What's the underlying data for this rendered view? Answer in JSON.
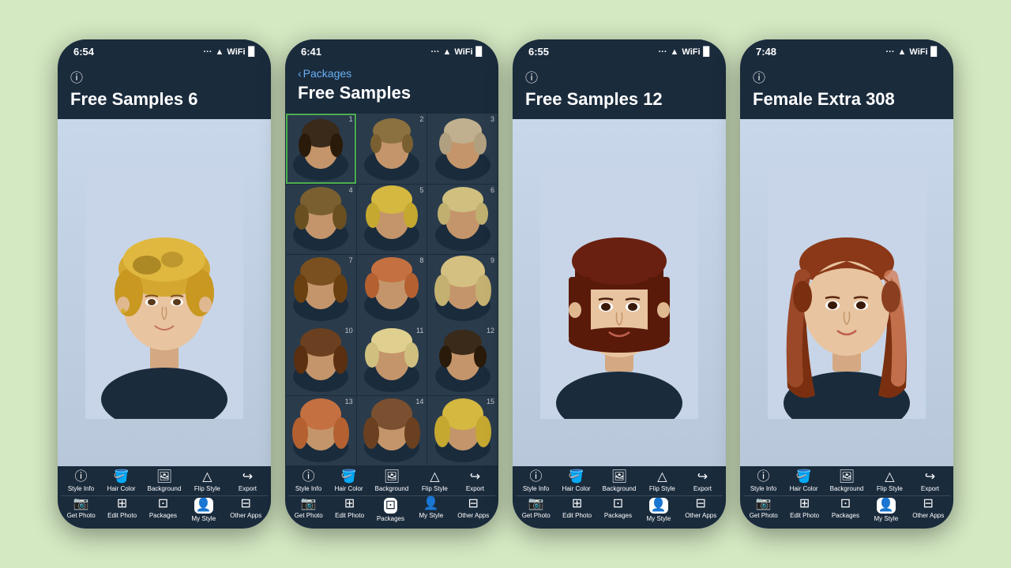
{
  "background_color": "#d4e8c2",
  "phones": [
    {
      "id": "phone1",
      "time": "6:54",
      "title": "Free Samples 6",
      "show_info": true,
      "active_tab": "my_style",
      "type": "main_photo"
    },
    {
      "id": "phone2",
      "time": "6:41",
      "title": "Free Samples",
      "back_label": "Packages",
      "show_back": true,
      "active_tab": "packages",
      "type": "grid",
      "grid_count": 15,
      "selected_cell": 1
    },
    {
      "id": "phone3",
      "time": "6:55",
      "title": "Free Samples 12",
      "show_info": true,
      "active_tab": "my_style",
      "type": "main_photo"
    },
    {
      "id": "phone4",
      "time": "7:48",
      "title": "Female Extra 308",
      "show_info": true,
      "active_tab": "my_style",
      "type": "main_photo"
    }
  ],
  "toolbar_rows": [
    [
      {
        "id": "style_info",
        "icon": "ℹ",
        "label": "Style Info"
      },
      {
        "id": "hair_color",
        "icon": "🪣",
        "label": "Hair Color"
      },
      {
        "id": "background",
        "icon": "🖼",
        "label": "Background"
      },
      {
        "id": "flip_style",
        "icon": "△",
        "label": "Flip Style"
      },
      {
        "id": "export",
        "icon": "↪",
        "label": "Export"
      }
    ],
    [
      {
        "id": "get_photo",
        "icon": "📷",
        "label": "Get Photo"
      },
      {
        "id": "edit_photo",
        "icon": "⊞",
        "label": "Edit Photo"
      },
      {
        "id": "packages",
        "icon": "⊡",
        "label": "Packages"
      },
      {
        "id": "my_style",
        "icon": "👤",
        "label": "My Style"
      },
      {
        "id": "other_apps",
        "icon": "⊟",
        "label": "Other Apps"
      }
    ]
  ],
  "status_icons": "··· ▲ 📶 🔋"
}
